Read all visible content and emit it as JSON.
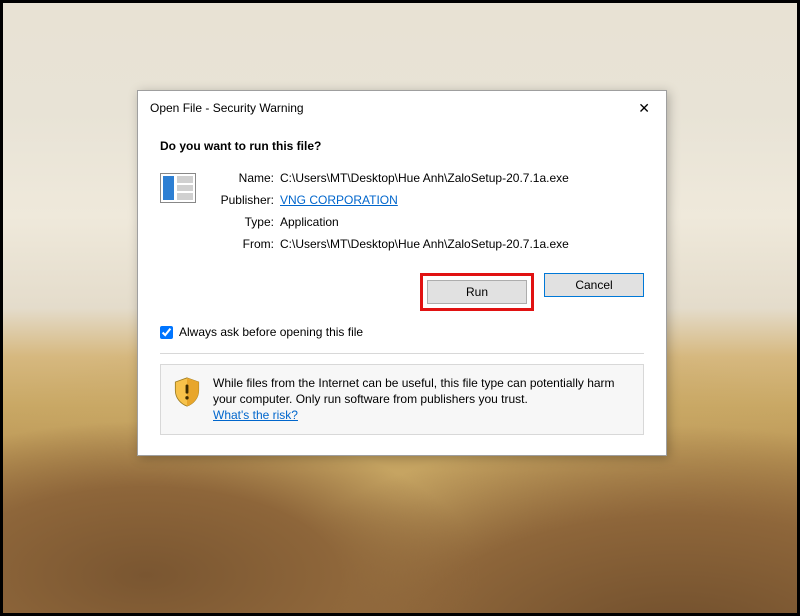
{
  "dialog": {
    "title": "Open File - Security Warning",
    "heading": "Do you want to run this file?",
    "fields": {
      "name_label": "Name:",
      "name_value": "C:\\Users\\MT\\Desktop\\Hue Anh\\ZaloSetup-20.7.1a.exe",
      "publisher_label": "Publisher:",
      "publisher_value": "VNG CORPORATION",
      "type_label": "Type:",
      "type_value": "Application",
      "from_label": "From:",
      "from_value": "C:\\Users\\MT\\Desktop\\Hue Anh\\ZaloSetup-20.7.1a.exe"
    },
    "buttons": {
      "run": "Run",
      "cancel": "Cancel"
    },
    "checkbox_label": "Always ask before opening this file",
    "checkbox_checked": true,
    "warning": {
      "text": "While files from the Internet can be useful, this file type can potentially harm your computer. Only run software from publishers you trust.",
      "link": "What's the risk?"
    }
  }
}
